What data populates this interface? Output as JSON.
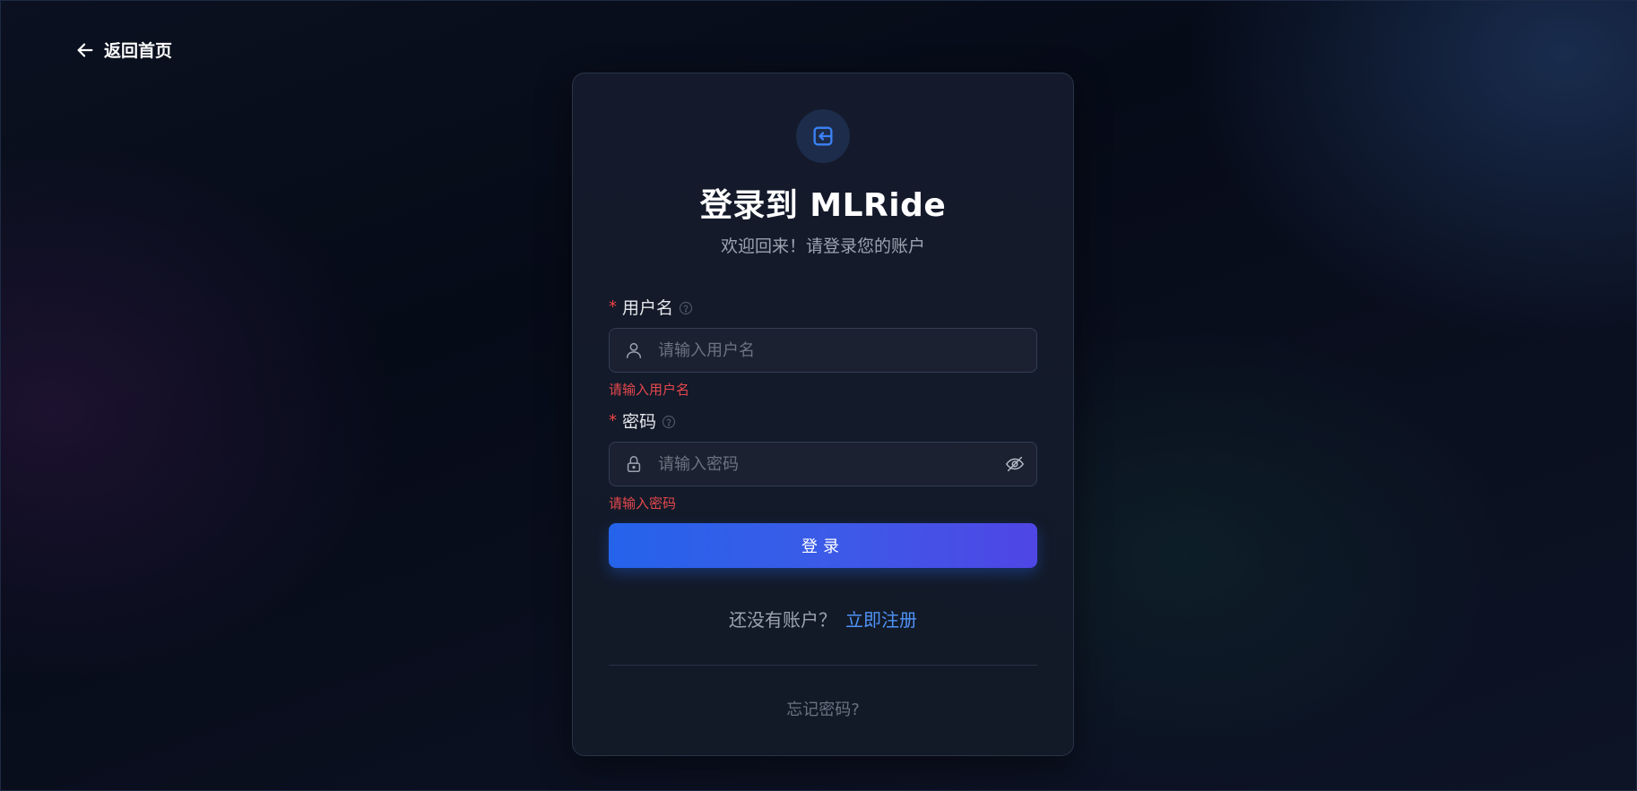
{
  "header": {
    "back_label": "返回首页"
  },
  "card": {
    "icon": "login-icon",
    "title": "登录到 MLRide",
    "subtitle": "欢迎回来！请登录您的账户"
  },
  "form": {
    "username": {
      "required_mark": "*",
      "label": "用户名",
      "placeholder": "请输入用户名",
      "value": "",
      "error": "请输入用户名",
      "prefix_icon": "user-icon",
      "help_icon": "question-circle-icon"
    },
    "password": {
      "required_mark": "*",
      "label": "密码",
      "placeholder": "请输入密码",
      "value": "",
      "error": "请输入密码",
      "prefix_icon": "lock-icon",
      "suffix_icon": "eye-off-icon",
      "help_icon": "question-circle-icon"
    },
    "submit_label": "登录"
  },
  "footer": {
    "register_prompt": "还没有账户？",
    "register_link": "立即注册",
    "forgot_password": "忘记密码?"
  },
  "colors": {
    "accent": "#3b82f6",
    "button_start": "#2563eb",
    "button_end": "#4f46e5",
    "error": "#e5484d",
    "link": "#4f93f7"
  }
}
